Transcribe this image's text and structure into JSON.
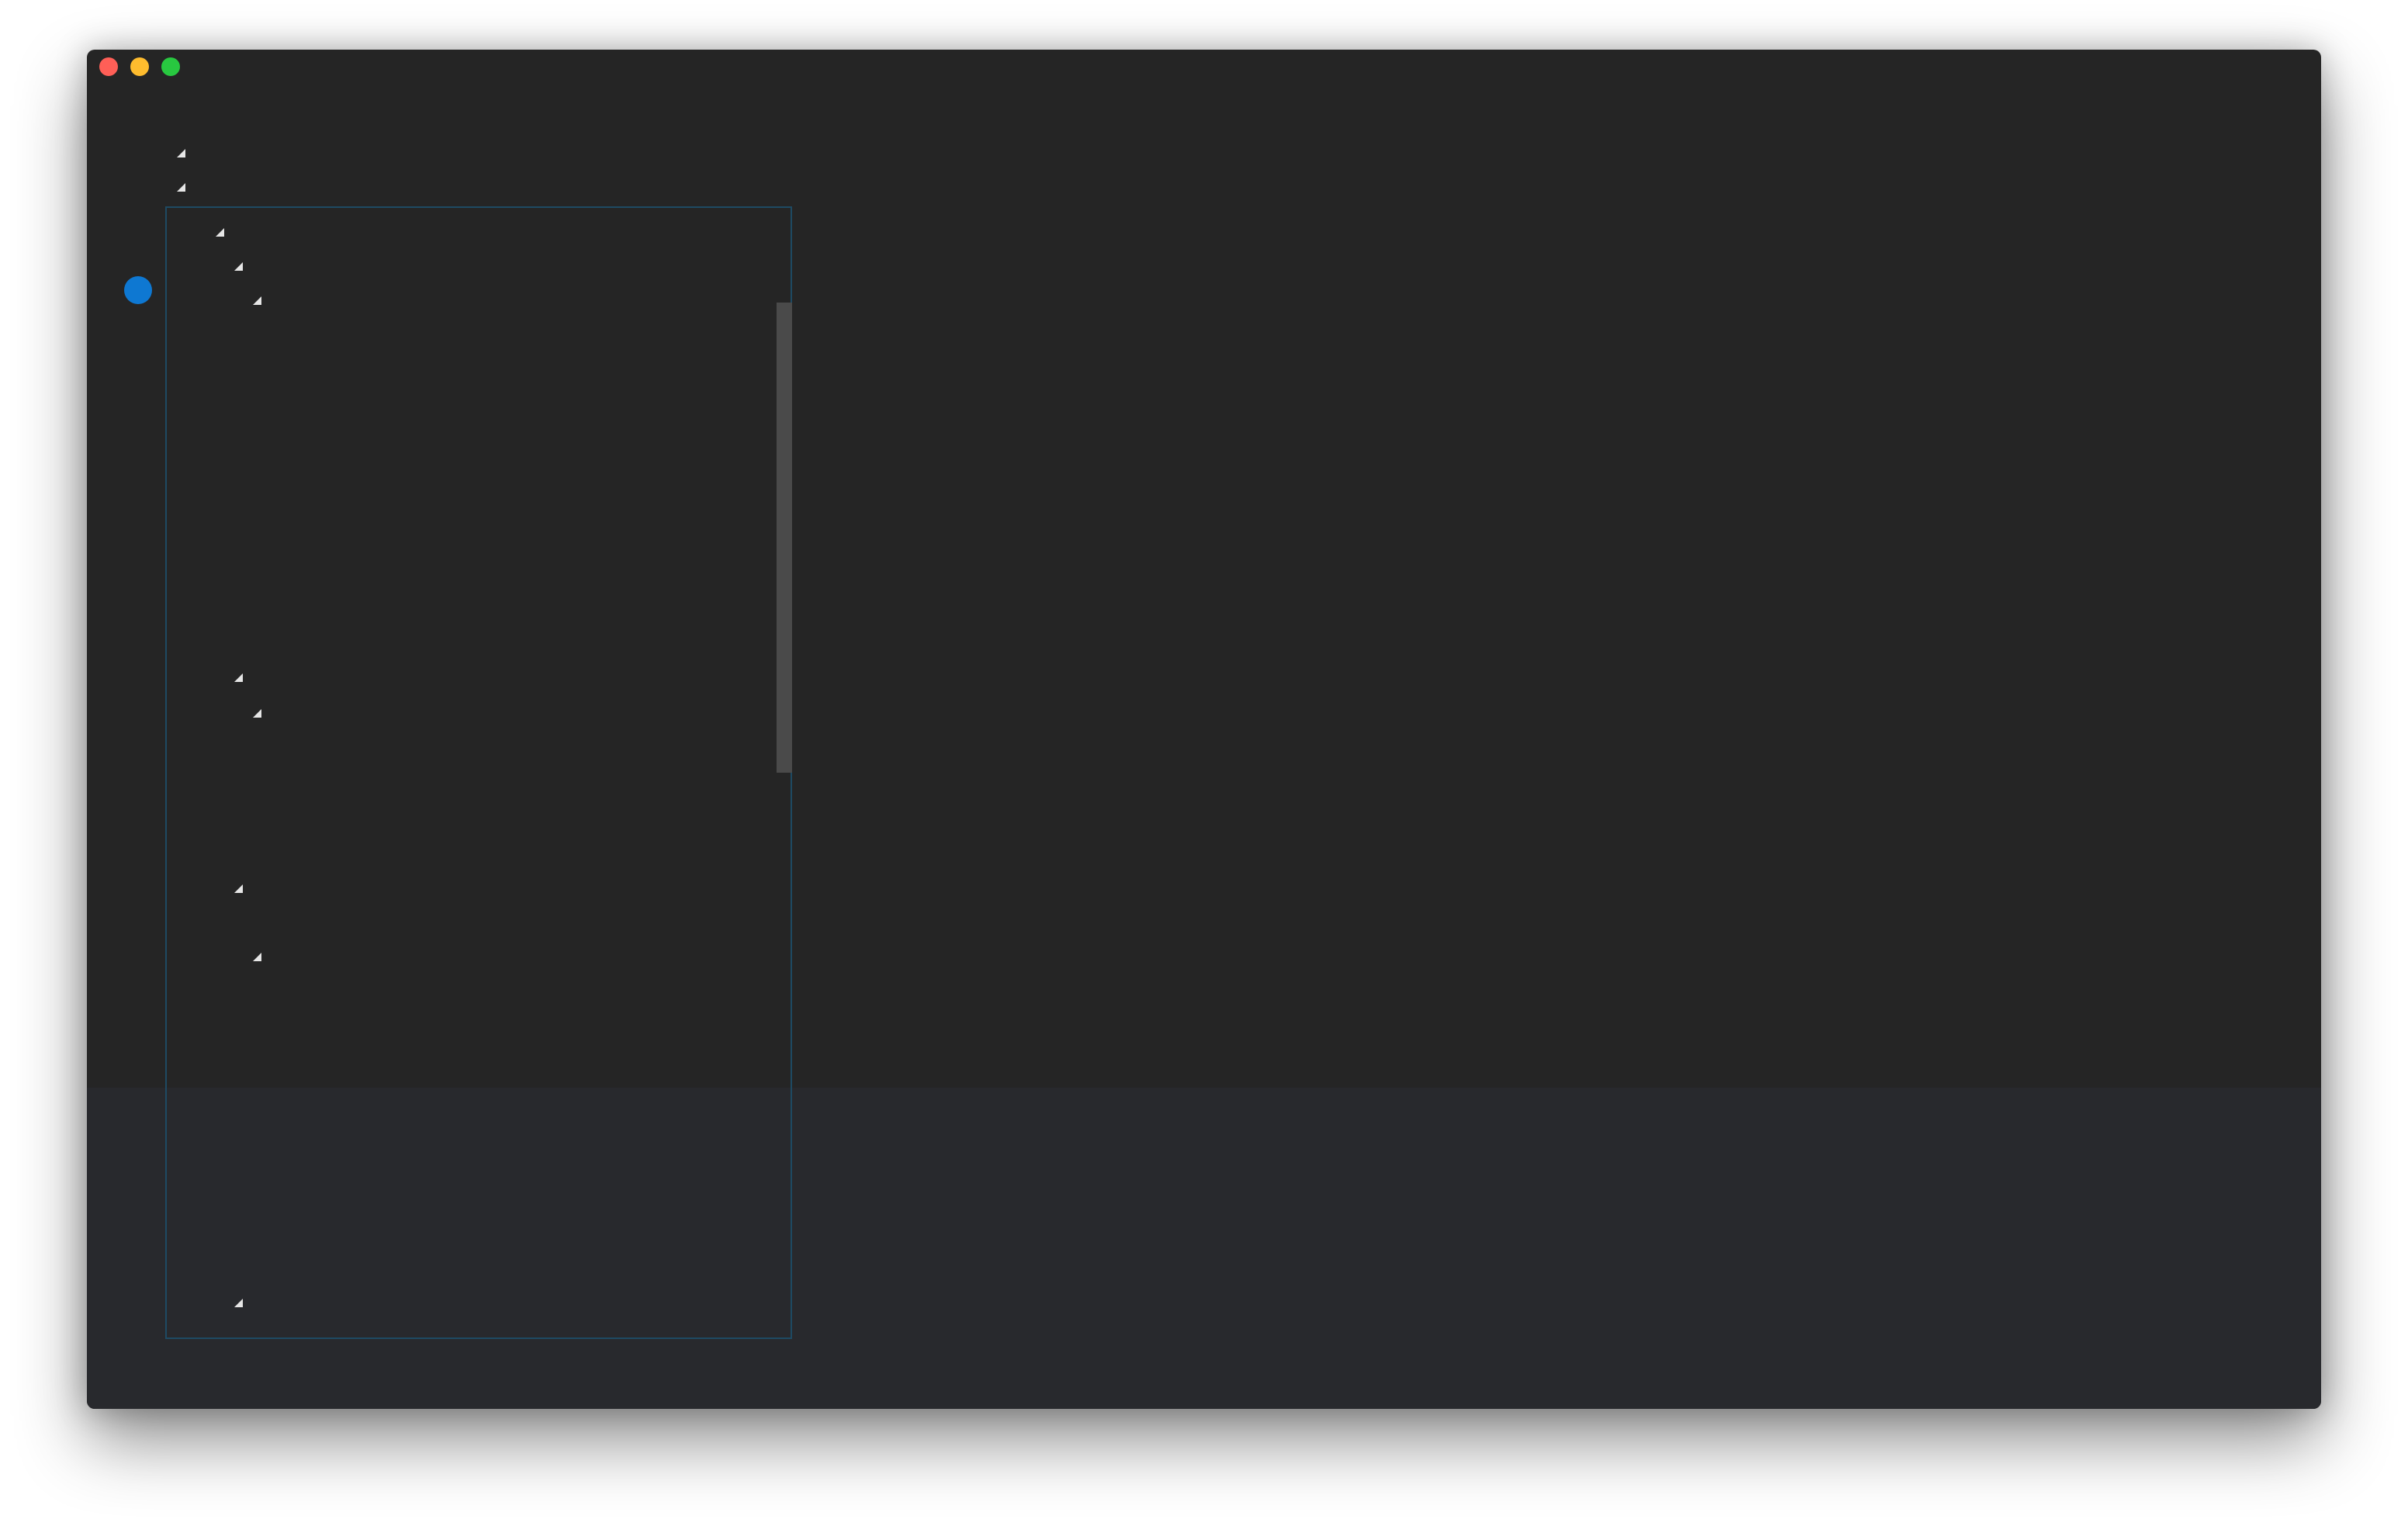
{
  "window": {
    "controls": [
      {
        "name": "close",
        "color": "#ff5f57"
      },
      {
        "name": "minimize",
        "color": "#febc2e"
      },
      {
        "name": "zoom",
        "color": "#28c840"
      }
    ]
  },
  "tree": {
    "expanded_nodes_count": 11
  },
  "colors": {
    "background": "#252525",
    "bottom_pane": "#28292d",
    "panel_border": "#1e4a63",
    "scrollbar": "#4a4a4a",
    "breakpoint": "#0e78d2",
    "triangle": "#e6e6e6"
  },
  "icons": {
    "expand": "triangle-expanded-icon",
    "breakpoint": "breakpoint-dot-icon"
  }
}
